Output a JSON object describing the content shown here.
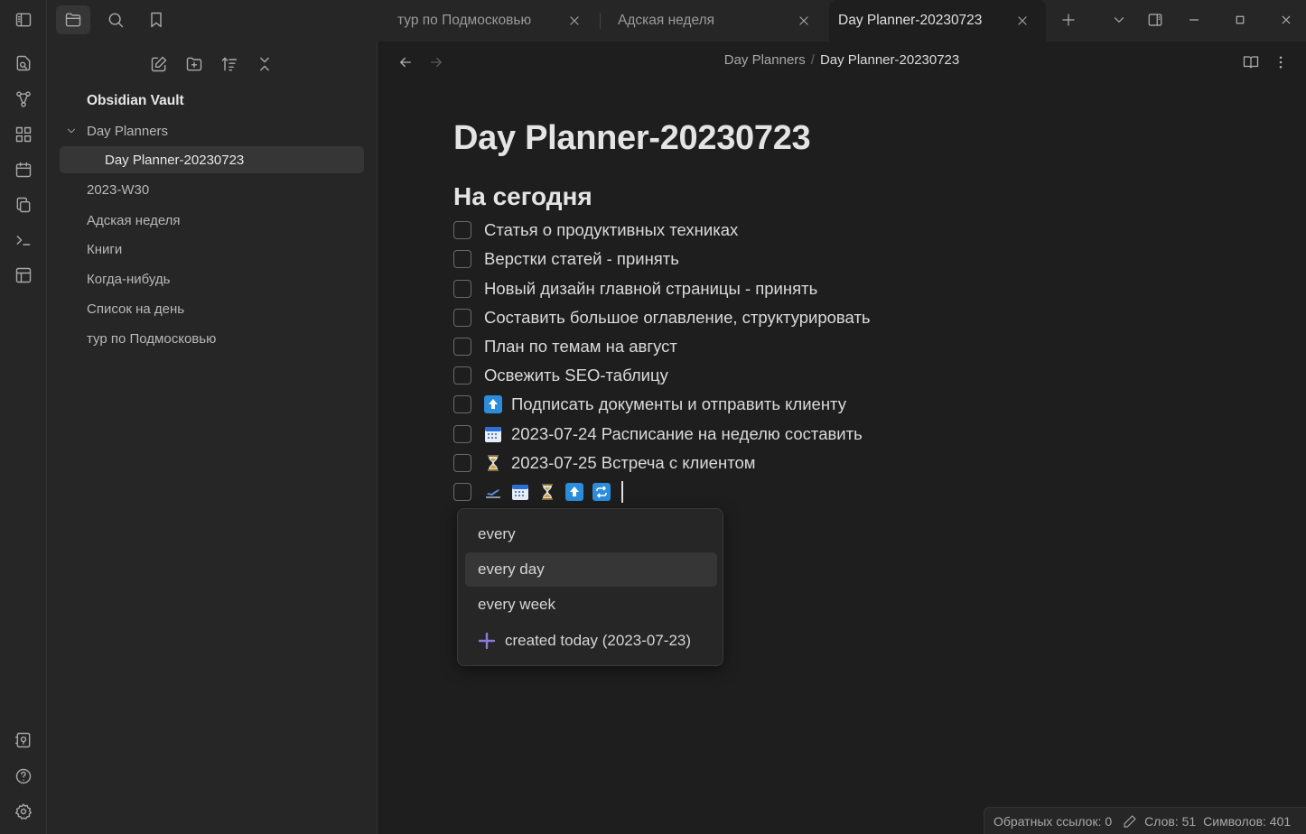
{
  "tabs": [
    {
      "label": "тур по Подмосковью",
      "active": false
    },
    {
      "label": "Адская неделя",
      "active": false
    },
    {
      "label": "Day Planner-20230723",
      "active": true
    }
  ],
  "sidebar": {
    "vault_name": "Obsidian Vault",
    "folder": {
      "label": "Day Planners",
      "children": [
        {
          "label": "Day Planner-20230723"
        }
      ]
    },
    "items": [
      {
        "label": "2023-W30"
      },
      {
        "label": "Адская неделя"
      },
      {
        "label": "Книги"
      },
      {
        "label": "Когда-нибудь"
      },
      {
        "label": "Список на день"
      },
      {
        "label": "тур по Подмосковью"
      }
    ]
  },
  "breadcrumb": {
    "folder": "Day Planners",
    "separator": "/",
    "current": "Day Planner-20230723"
  },
  "document": {
    "title": "Day Planner-20230723",
    "heading": "На сегодня",
    "tasks": [
      {
        "text": "Статья о продуктивных техниках",
        "emoji": ""
      },
      {
        "text": "Верстки статей - принять",
        "emoji": ""
      },
      {
        "text": "Новый дизайн главной страницы - принять",
        "emoji": ""
      },
      {
        "text": "Составить большое оглавление, структурировать",
        "emoji": ""
      },
      {
        "text": "План по темам на август",
        "emoji": ""
      },
      {
        "text": "Освежить SEO-таблицу",
        "emoji": ""
      },
      {
        "text": "Подписать документы и отправить клиенту",
        "emoji": "up-arrow-icon"
      },
      {
        "text": "2023-07-24 Расписание на неделю составить",
        "emoji": "calendar-icon"
      },
      {
        "text": "2023-07-25 Встреча с клиентом",
        "emoji": "hourglass-icon"
      }
    ],
    "editing_task_emojis": [
      "airplane-departure-icon",
      "calendar-icon",
      "hourglass-icon",
      "up-arrow-icon",
      "repeat-icon"
    ]
  },
  "suggestions": [
    {
      "label": "every",
      "highlighted": false
    },
    {
      "label": "every day",
      "highlighted": true
    },
    {
      "label": "every week",
      "highlighted": false
    },
    {
      "label": "created today (2023-07-23)",
      "highlighted": false,
      "icon": "plus-icon"
    }
  ],
  "statusbar": {
    "backlinks": "Обратных ссылок: 0",
    "words": "Слов: 51",
    "chars": "Символов: 401"
  },
  "colors": {
    "accent_plus": "#8b7ad6",
    "emoji_blue": "#2b8ddb",
    "hourglass": "#e0a030"
  }
}
